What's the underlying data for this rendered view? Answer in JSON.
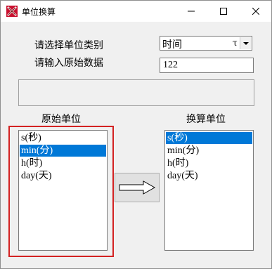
{
  "window": {
    "title": "单位换算",
    "icon": "app-icon"
  },
  "form": {
    "category_label": "请选择单位类别",
    "input_label": "请输入原始数据",
    "category_value": "时间",
    "category_symbol": "τ",
    "input_value": "122"
  },
  "source": {
    "title": "原始单位",
    "items": [
      "s(秒)",
      "min(分)",
      "h(时)",
      "day(天)"
    ],
    "selected_index": 1
  },
  "target": {
    "title": "换算单位",
    "items": [
      "s(秒)",
      "min(分)",
      "h(时)",
      "day(天)"
    ],
    "selected_index": 0
  },
  "colors": {
    "selection": "#0078d7",
    "highlight_border": "#d32222"
  },
  "icons": [
    "minimize-icon",
    "maximize-icon",
    "close-icon",
    "right-arrow-icon",
    "chevron-down-icon"
  ]
}
